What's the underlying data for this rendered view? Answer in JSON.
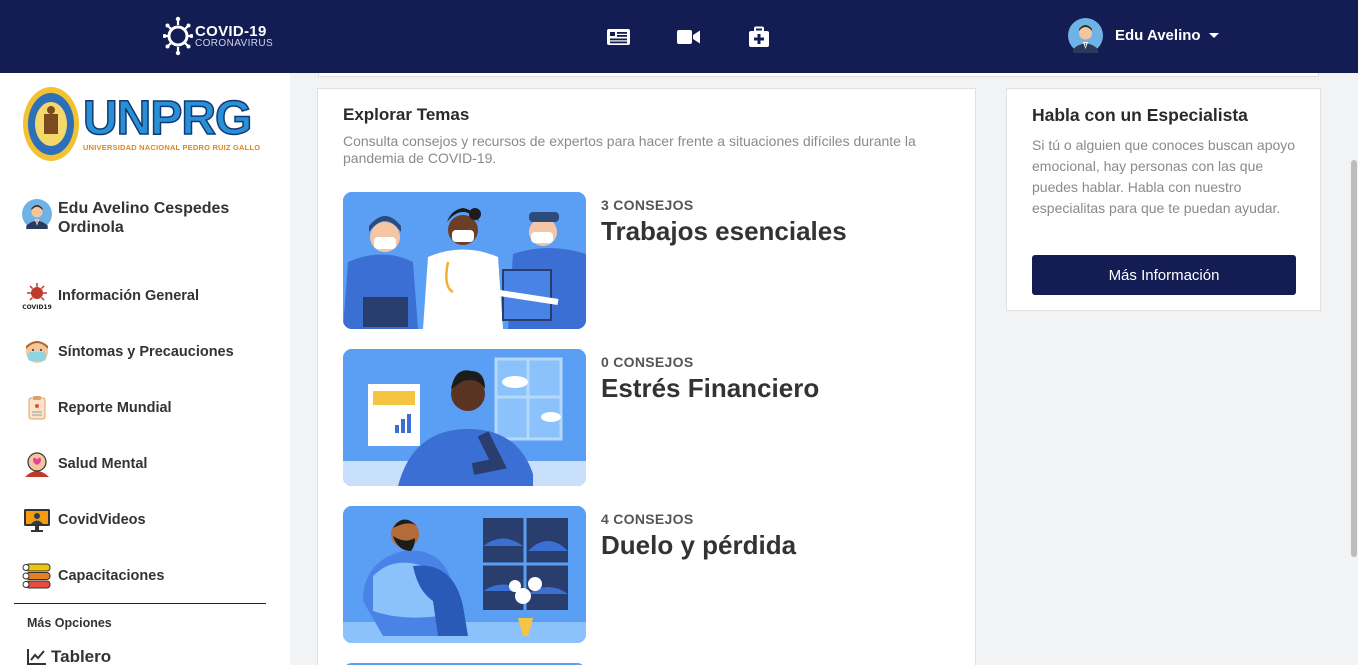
{
  "header": {
    "logo_title": "COVID-19",
    "logo_subtitle": "CORONAVIRUS",
    "nav_icons": [
      "news-icon",
      "video-camera-icon",
      "first-aid-kit-icon"
    ],
    "user_name": "Edu Avelino"
  },
  "sidebar": {
    "university_short": "UNPRG",
    "university_full": "UNIVERSIDAD NACIONAL PEDRO RUIZ GALLO",
    "profile_name": "Edu Avelino Cespedes Ordinola",
    "items": [
      {
        "label": "Información General",
        "icon": "covid19-virus-icon"
      },
      {
        "label": "Síntomas y Precauciones",
        "icon": "masked-person-icon"
      },
      {
        "label": "Reporte Mundial",
        "icon": "report-clipboard-icon"
      },
      {
        "label": "Salud Mental",
        "icon": "mental-health-icon"
      },
      {
        "label": "CovidVideos",
        "icon": "video-monitor-icon"
      },
      {
        "label": "Capacitaciones",
        "icon": "training-list-icon"
      }
    ],
    "more_options_label": "Más Opciones",
    "dashboard_label": "Tablero"
  },
  "main": {
    "title": "Explorar Temas",
    "description": "Consulta consejos y recursos de expertos para hacer frente a situaciones difíciles durante la pandemia de COVID-19.",
    "topics": [
      {
        "count": "3 CONSEJOS",
        "name": "Trabajos esenciales",
        "image": "essential-workers-illustration"
      },
      {
        "count": "0 CONSEJOS",
        "name": "Estrés Financiero",
        "image": "financial-stress-illustration"
      },
      {
        "count": "4 CONSEJOS",
        "name": "Duelo y pérdida",
        "image": "grief-loss-illustration"
      }
    ]
  },
  "specialist": {
    "title": "Habla con un Especialista",
    "text": "Si tú o alguien que conoces buscan apoyo emocional, hay personas con las que puedes hablar. Habla con nuestro especialitas para que te puedan ayudar.",
    "button_label": "Más Información"
  },
  "colors": {
    "header_bg": "#131c53",
    "accent_blue": "#5b9ff5",
    "button_bg": "#131c53"
  }
}
